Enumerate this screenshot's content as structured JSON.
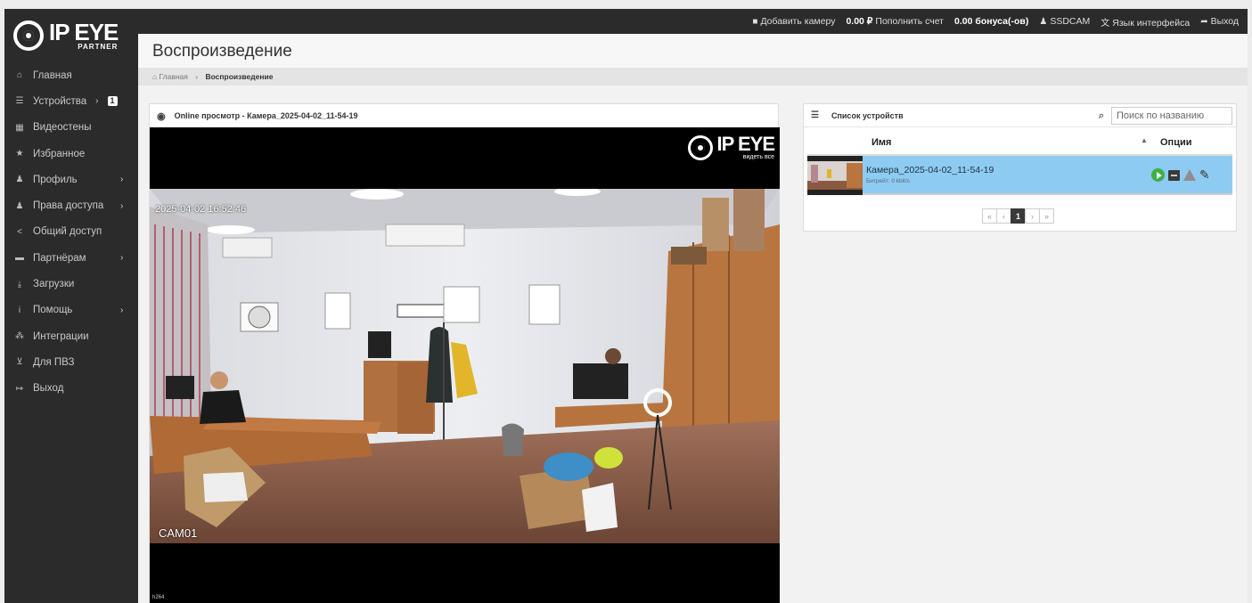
{
  "brand": {
    "name": "IP EYE",
    "tagline": "PARTNER"
  },
  "topbar": {
    "add_camera": "Добавить камеру",
    "balance": "0.00 ₽",
    "topup": "Пополнить счет",
    "bonus": "0.00 бонуса(-ов)",
    "user": "SSDCAM",
    "language": "Язык интерфейса",
    "logout": "Выход"
  },
  "sidebar": {
    "items": [
      {
        "label": "Главная",
        "icon": "home-icon"
      },
      {
        "label": "Устройства",
        "icon": "list-icon",
        "badge": "1"
      },
      {
        "label": "Видеостены",
        "icon": "grid-icon"
      },
      {
        "label": "Избранное",
        "icon": "star-icon"
      },
      {
        "label": "Профиль",
        "icon": "user-icon"
      },
      {
        "label": "Права доступа",
        "icon": "users-icon"
      },
      {
        "label": "Общий доступ",
        "icon": "share-icon"
      },
      {
        "label": "Партнёрам",
        "icon": "briefcase-icon"
      },
      {
        "label": "Загрузки",
        "icon": "download-icon"
      },
      {
        "label": "Помощь",
        "icon": "info-icon"
      },
      {
        "label": "Интеграции",
        "icon": "sitemap-icon"
      },
      {
        "label": "Для ПВЗ",
        "icon": "cart-icon"
      },
      {
        "label": "Выход",
        "icon": "sign-out-icon"
      }
    ]
  },
  "page": {
    "title": "Воспроизведение",
    "breadcrumb": {
      "home": "Главная",
      "current": "Воспроизведение"
    }
  },
  "player": {
    "header": "Online просмотр - Камера_2025-04-02_11-54-19",
    "overlay_logo": "IP EYE",
    "overlay_tagline": "видеть все",
    "timestamp": "2025-04-02 16:52:46",
    "camera_label": "CAM01",
    "codec": "h264"
  },
  "devices": {
    "title": "Список устройств",
    "search_placeholder": "Поиск по названию",
    "col_name": "Имя",
    "col_options": "Опции",
    "rows": [
      {
        "name": "Камера_2025-04-02_11-54-19",
        "bitrate": "Битрейт: 0 kbit/s"
      }
    ],
    "pager": {
      "first": "«",
      "prev": "‹",
      "page": "1",
      "next": "›",
      "last": "»"
    }
  },
  "colors": {
    "sidebar": "#2b2b2b",
    "row_selected": "#8ecbf2",
    "play": "#3cb043"
  }
}
